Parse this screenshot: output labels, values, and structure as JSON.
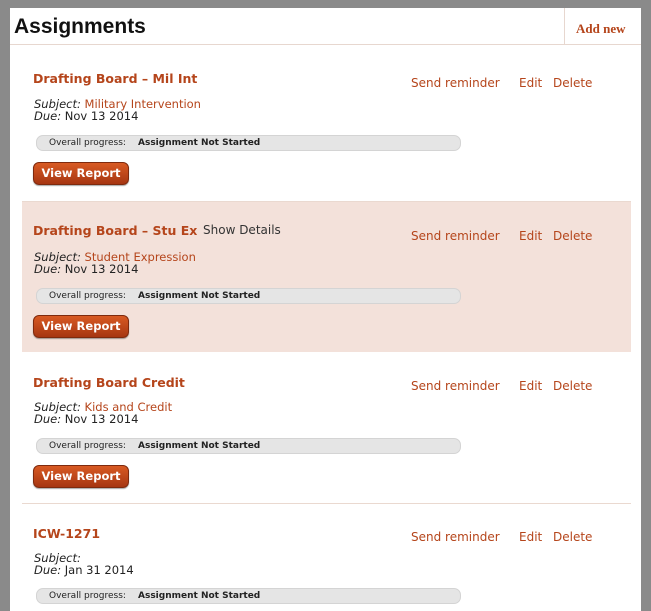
{
  "header": {
    "title": "Assignments",
    "add_new": "Add new"
  },
  "common": {
    "subject_label": "Subject:",
    "due_label": "Due:",
    "progress_label": "Overall progress:",
    "view_report": "View Report",
    "send_reminder": "Send reminder",
    "edit": "Edit",
    "delete": "Delete",
    "show_details": "Show Details"
  },
  "assignments": [
    {
      "name": "Drafting Board – Mil Int",
      "subject": "Military Intervention",
      "due": "Nov 13 2014",
      "status": "Assignment Not Started"
    },
    {
      "name": "Drafting Board – Stu Ex",
      "subject": "Student Expression",
      "due": "Nov 13 2014",
      "status": "Assignment Not Started"
    },
    {
      "name": "Drafting Board Credit",
      "subject": "Kids and Credit",
      "due": "Nov 13 2014",
      "status": "Assignment Not Started"
    },
    {
      "name": "ICW-1271",
      "subject": "",
      "due": "Jan 31 2014",
      "status": "Assignment Not Started"
    }
  ],
  "colors": {
    "accent": "#b5451b",
    "highlight_row": "#f3e1da",
    "frame": "#8a8a8a"
  }
}
